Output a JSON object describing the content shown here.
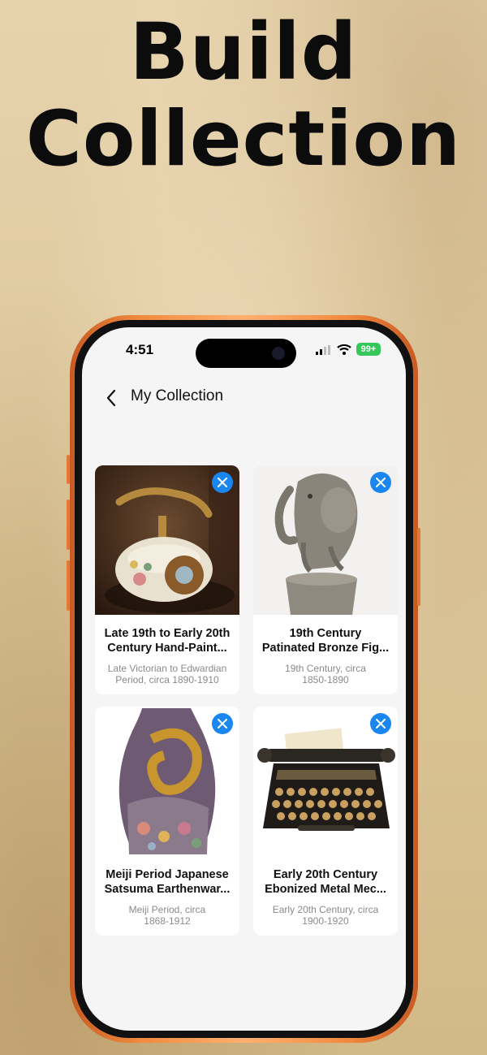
{
  "headline": {
    "line1": "Build",
    "line2": "Collection"
  },
  "status_bar": {
    "time": "4:51",
    "battery": "99+"
  },
  "nav": {
    "title": "My Collection"
  },
  "items": [
    {
      "title_l1": "Late 19th to Early 20th",
      "title_l2": "Century Hand-Paint...",
      "period_l1": "Late Victorian to Edwardian",
      "period_l2": "Period, circa 1890-1910",
      "image_icon": "antique-telephone-image"
    },
    {
      "title_l1": "19th Century",
      "title_l2": "Patinated Bronze Fig...",
      "period_l1": "19th Century, circa",
      "period_l2": "1850-1890",
      "image_icon": "bronze-elephant-figure-image"
    },
    {
      "title_l1": "Meiji Period Japanese",
      "title_l2": "Satsuma Earthenwar...",
      "period_l1": "Meiji Period, circa",
      "period_l2": "1868-1912",
      "image_icon": "satsuma-vase-image"
    },
    {
      "title_l1": "Early 20th Century",
      "title_l2": "Ebonized Metal Mec...",
      "period_l1": "Early 20th Century, circa",
      "period_l2": "1900-1920",
      "image_icon": "typewriter-image"
    }
  ],
  "colors": {
    "accent": "#1a86f0",
    "battery": "#34c759",
    "phone_frame": "#f08a3e"
  }
}
